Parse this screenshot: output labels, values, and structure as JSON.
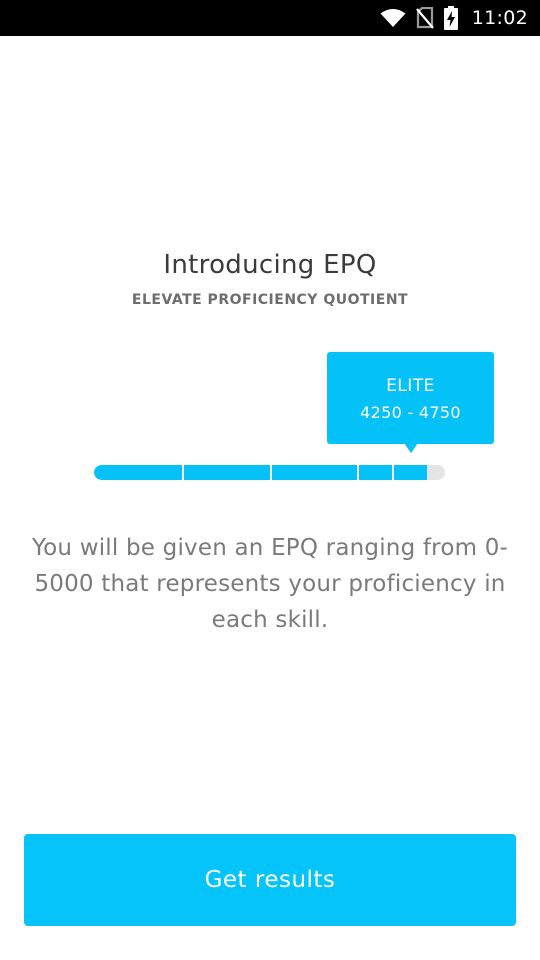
{
  "status_bar": {
    "time": "11:02",
    "icons": [
      "wifi-icon",
      "no-sim-icon",
      "battery-charging-icon"
    ]
  },
  "intro": {
    "title": "Introducing EPQ",
    "subtitle": "ELEVATE PROFICIENCY QUOTIENT"
  },
  "scale": {
    "level": "ELITE",
    "range": "4250 - 4750",
    "fill_fraction": 0.95,
    "segment_boundaries": [
      0.25,
      0.5,
      0.75,
      0.85
    ],
    "colors": {
      "fill": "#04c1f7",
      "track": "#e4e4e4"
    }
  },
  "description": "You will be given an EPQ ranging from 0-5000 that represents your proficiency in each skill.",
  "cta": {
    "label": "Get results",
    "color": "#04c4f9"
  }
}
